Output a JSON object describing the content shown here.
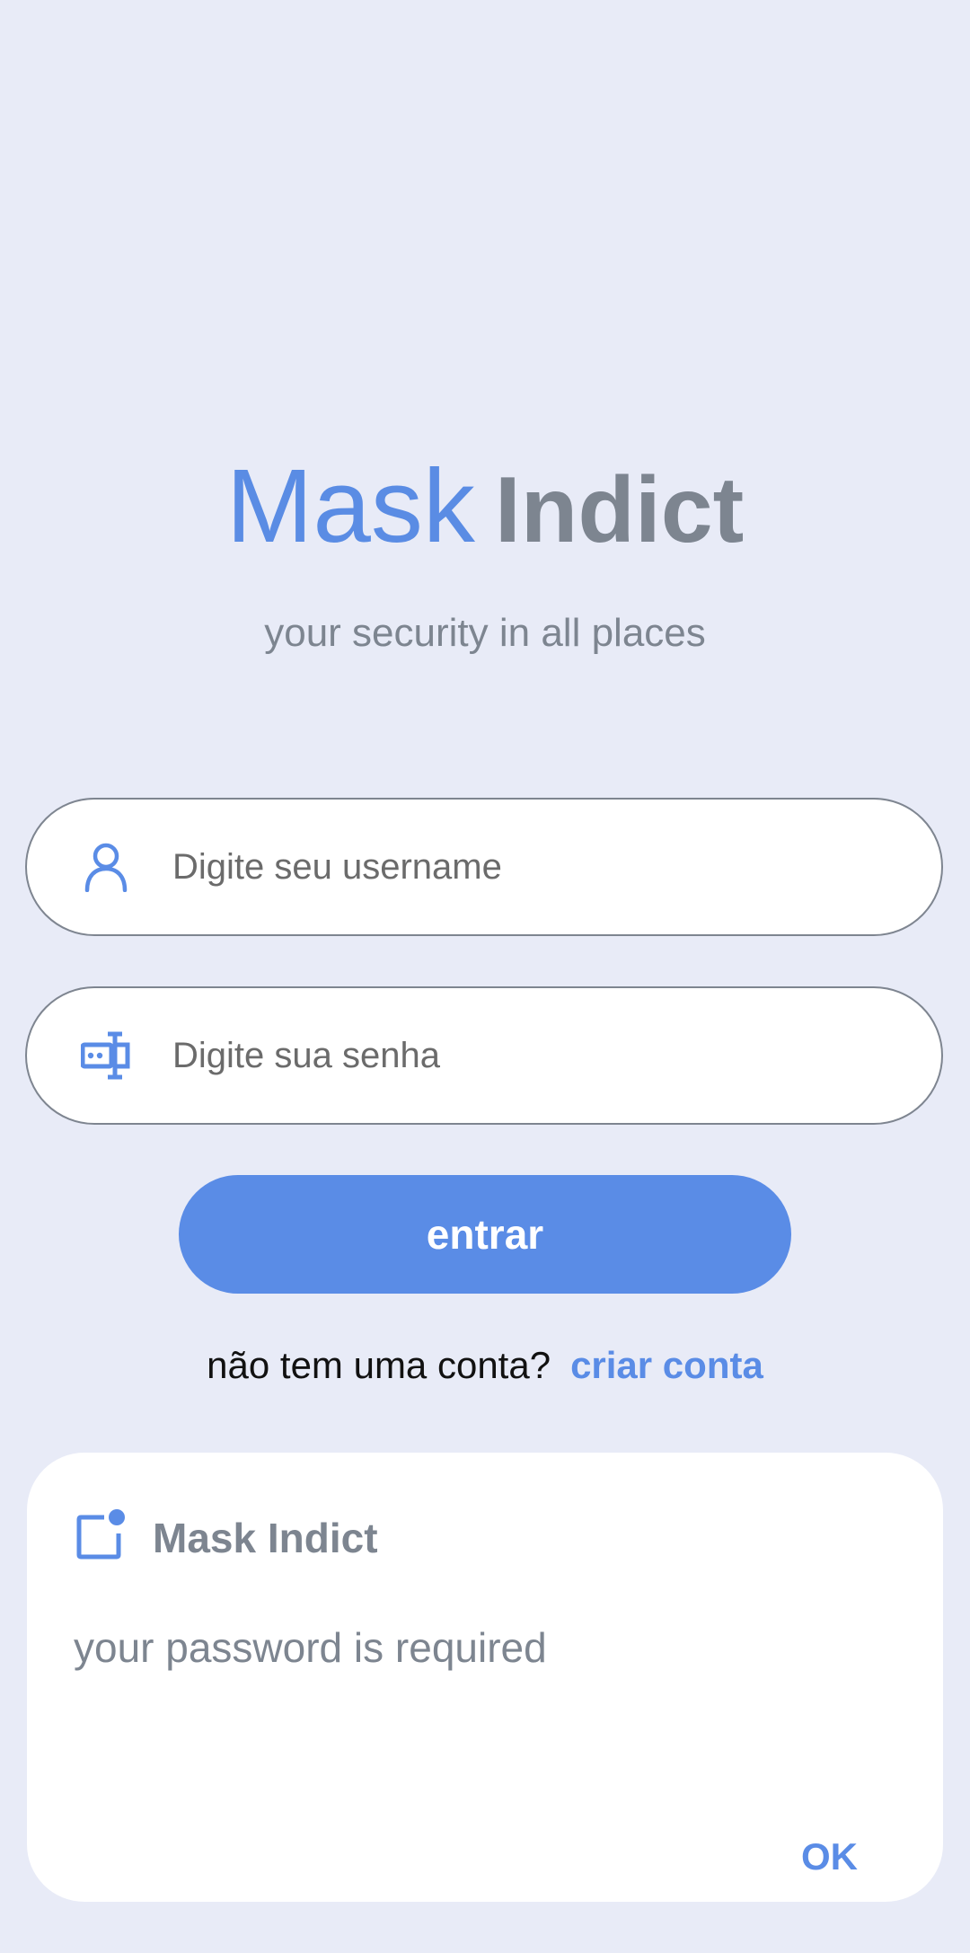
{
  "brand": {
    "name_part1": "Mask",
    "name_part2": "Indict",
    "tagline": "your security in all places"
  },
  "login_form": {
    "username": {
      "placeholder": "Digite seu username",
      "value": "",
      "icon": "person-icon"
    },
    "password": {
      "placeholder": "Digite sua senha",
      "value": "",
      "icon": "password-field-icon"
    },
    "submit_label": "entrar"
  },
  "signup": {
    "prompt": "não tem uma conta?",
    "link_label": "criar conta"
  },
  "dialog": {
    "icon": "notification-icon",
    "title": "Mask Indict",
    "message": "your password is required",
    "ok_label": "OK"
  },
  "colors": {
    "background": "#e8ebf7",
    "accent": "#5a8ce6",
    "muted_text": "#7d8590",
    "field_border": "#7e8590",
    "surface": "#ffffff"
  }
}
